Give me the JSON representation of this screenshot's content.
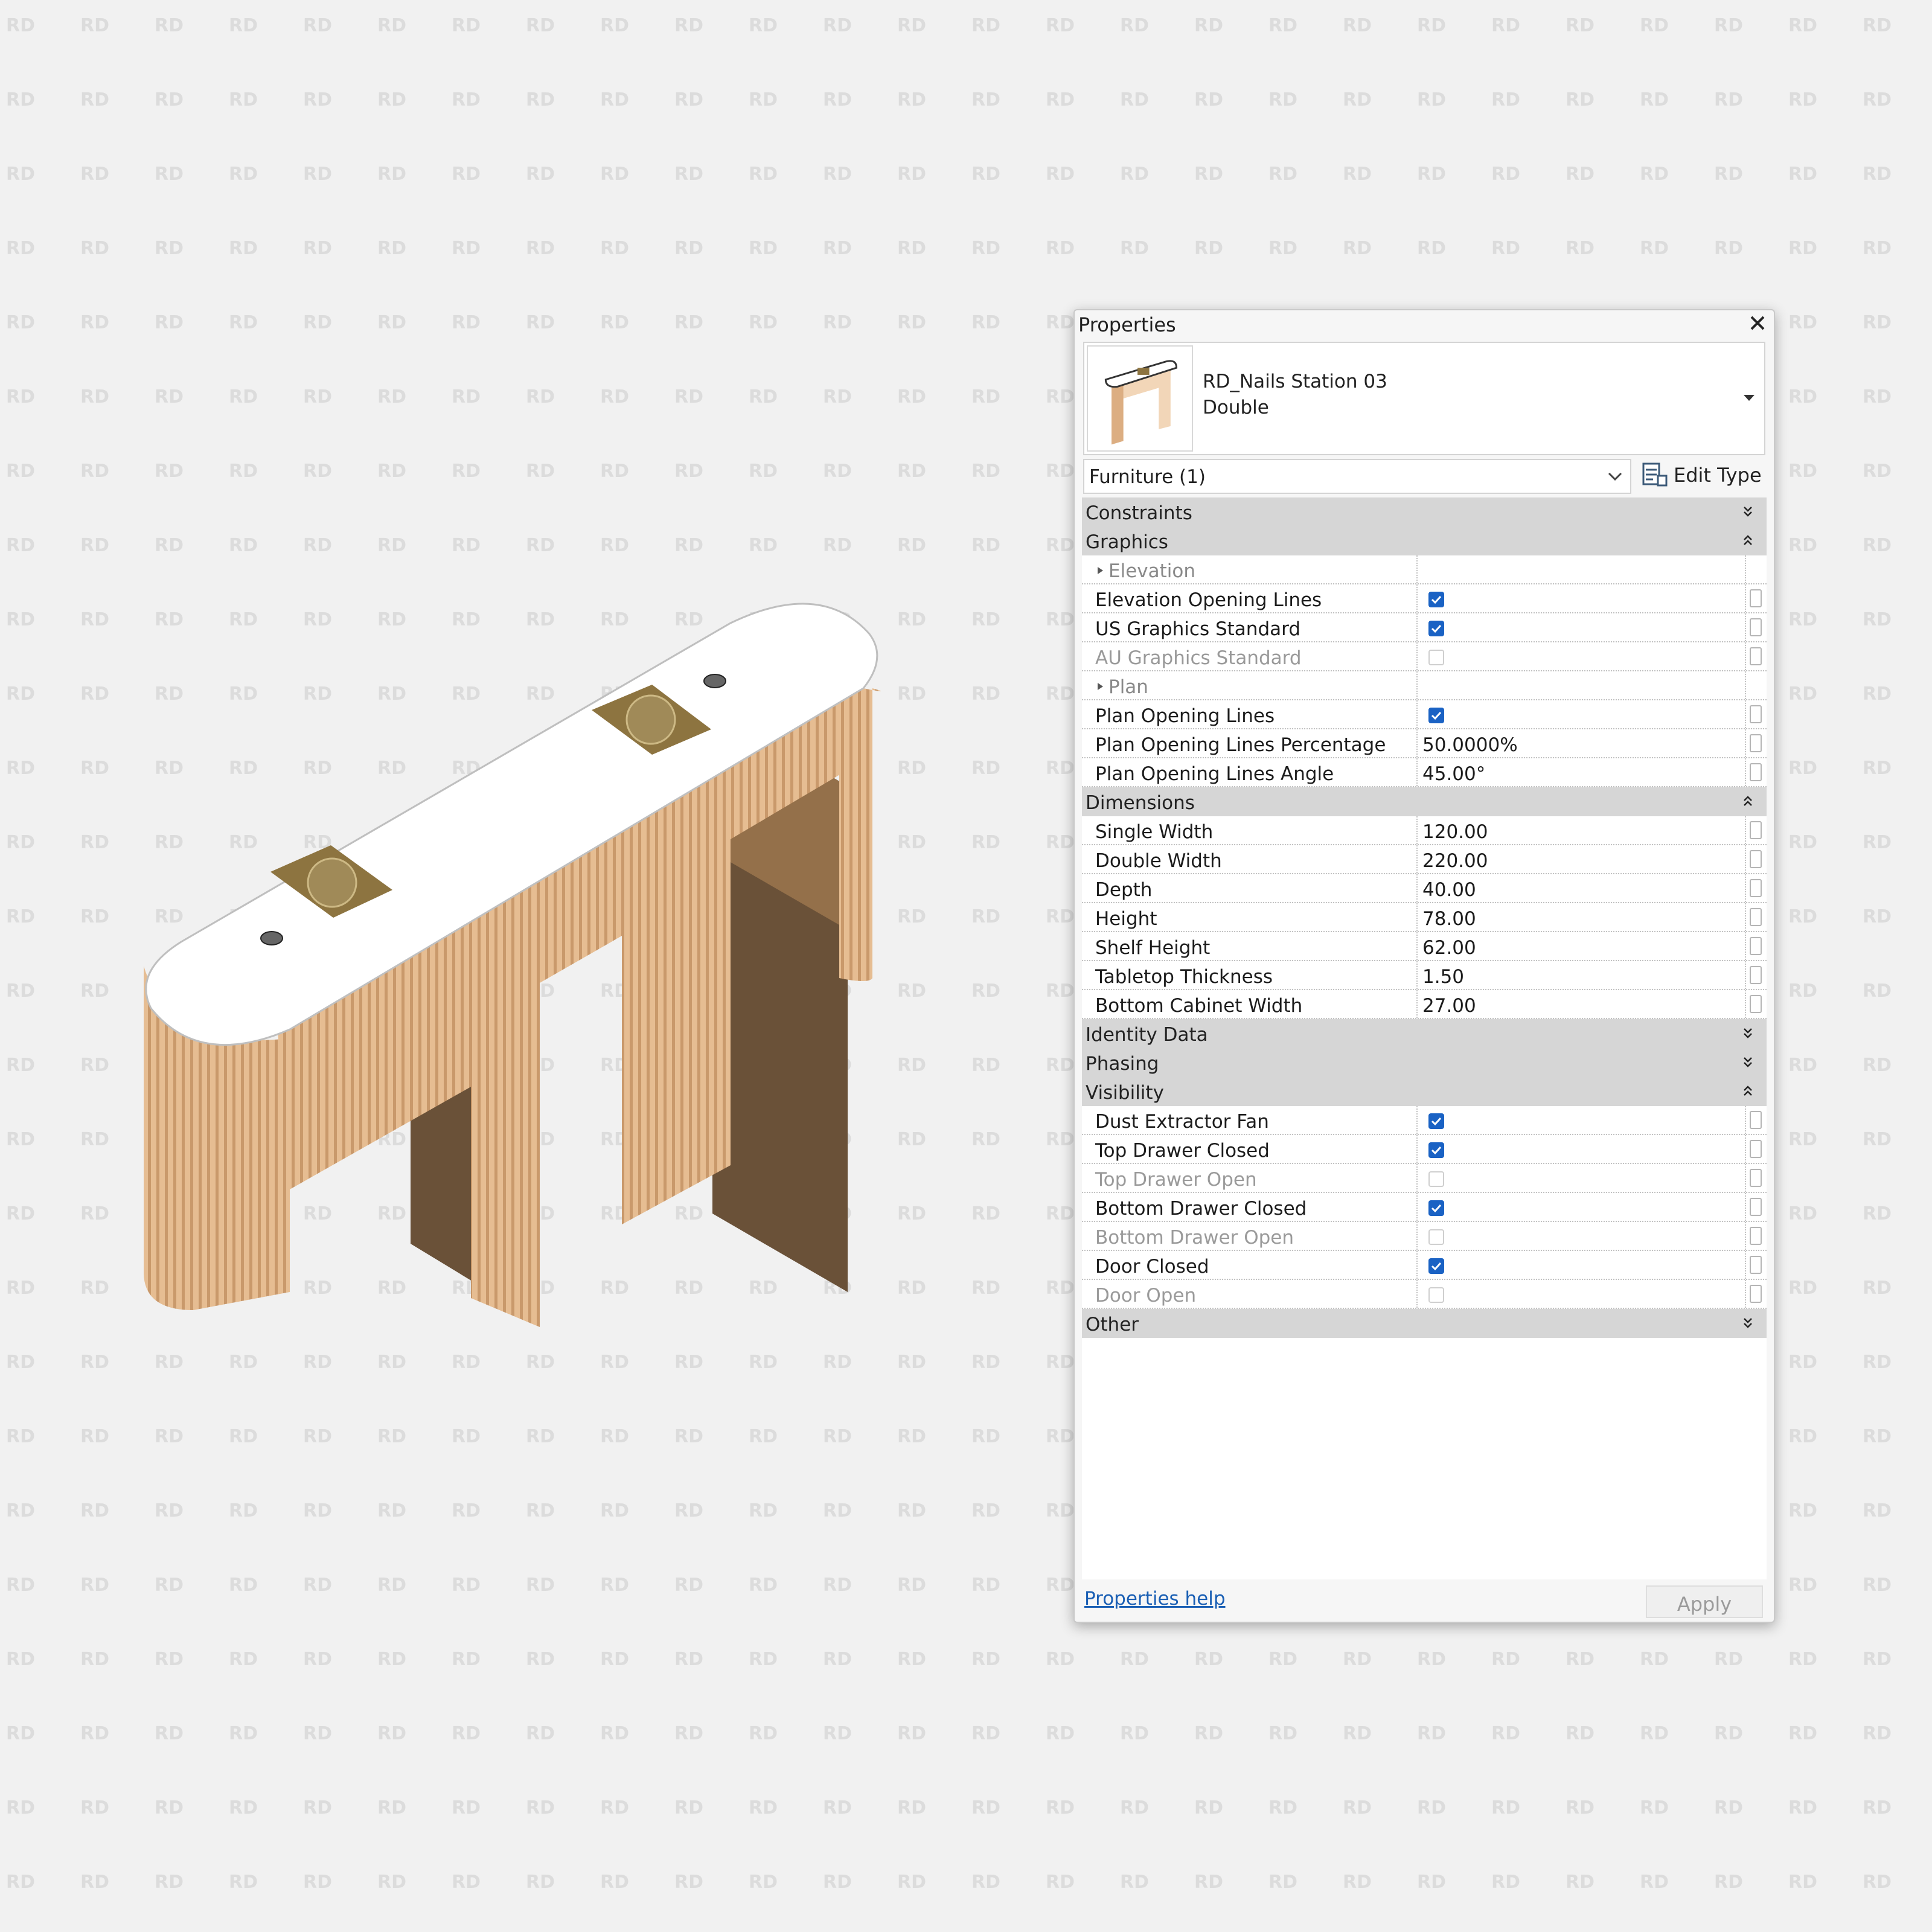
{
  "watermark_text": "RD",
  "panel": {
    "title": "Properties",
    "type_selector": {
      "family": "RD_Nails Station 03",
      "type": "Double"
    },
    "filter": {
      "value": "Furniture (1)"
    },
    "edit_type_label": "Edit Type",
    "help_link": "Properties help",
    "apply_label": "Apply"
  },
  "rows": [
    {
      "kind": "group",
      "label": "Constraints",
      "state": "collapsed"
    },
    {
      "kind": "group",
      "label": "Graphics",
      "state": "expanded"
    },
    {
      "kind": "subgroup",
      "label": "Elevation"
    },
    {
      "kind": "param",
      "name": "Elevation Opening Lines",
      "type": "checkbox",
      "checked": true,
      "enabled": true
    },
    {
      "kind": "param",
      "name": "US Graphics Standard",
      "type": "checkbox",
      "checked": true,
      "enabled": true
    },
    {
      "kind": "param",
      "name": "AU Graphics Standard",
      "type": "checkbox",
      "checked": false,
      "enabled": false
    },
    {
      "kind": "subgroup",
      "label": "Plan"
    },
    {
      "kind": "param",
      "name": "Plan Opening Lines",
      "type": "checkbox",
      "checked": true,
      "enabled": true
    },
    {
      "kind": "param",
      "name": "Plan Opening Lines Percentage",
      "type": "text",
      "value": "50.0000%",
      "enabled": true
    },
    {
      "kind": "param",
      "name": "Plan Opening Lines Angle",
      "type": "text",
      "value": "45.00°",
      "enabled": true
    },
    {
      "kind": "group",
      "label": "Dimensions",
      "state": "expanded"
    },
    {
      "kind": "param",
      "name": "Single Width",
      "type": "text",
      "value": "120.00",
      "enabled": true
    },
    {
      "kind": "param",
      "name": "Double Width",
      "type": "text",
      "value": "220.00",
      "enabled": true
    },
    {
      "kind": "param",
      "name": "Depth",
      "type": "text",
      "value": "40.00",
      "enabled": true
    },
    {
      "kind": "param",
      "name": "Height",
      "type": "text",
      "value": "78.00",
      "enabled": true
    },
    {
      "kind": "param",
      "name": "Shelf Height",
      "type": "text",
      "value": "62.00",
      "enabled": true
    },
    {
      "kind": "param",
      "name": "Tabletop Thickness",
      "type": "text",
      "value": "1.50",
      "enabled": true
    },
    {
      "kind": "param",
      "name": "Bottom Cabinet Width",
      "type": "text",
      "value": "27.00",
      "enabled": true
    },
    {
      "kind": "group",
      "label": "Identity Data",
      "state": "collapsed"
    },
    {
      "kind": "group",
      "label": "Phasing",
      "state": "collapsed"
    },
    {
      "kind": "group",
      "label": "Visibility",
      "state": "expanded"
    },
    {
      "kind": "param",
      "name": "Dust Extractor Fan",
      "type": "checkbox",
      "checked": true,
      "enabled": true
    },
    {
      "kind": "param",
      "name": "Top Drawer Closed",
      "type": "checkbox",
      "checked": true,
      "enabled": true
    },
    {
      "kind": "param",
      "name": "Top Drawer Open",
      "type": "checkbox",
      "checked": false,
      "enabled": false
    },
    {
      "kind": "param",
      "name": "Bottom Drawer Closed",
      "type": "checkbox",
      "checked": true,
      "enabled": true
    },
    {
      "kind": "param",
      "name": "Bottom Drawer Open",
      "type": "checkbox",
      "checked": false,
      "enabled": false
    },
    {
      "kind": "param",
      "name": "Door Closed",
      "type": "checkbox",
      "checked": true,
      "enabled": true
    },
    {
      "kind": "param",
      "name": "Door Open",
      "type": "checkbox",
      "checked": false,
      "enabled": false
    },
    {
      "kind": "group",
      "label": "Other",
      "state": "collapsed"
    }
  ],
  "colors": {
    "background": "#f1f1f1",
    "watermark": "#dcdcdc",
    "group_header": "#d6d6d6",
    "checkbox_checked": "#1a62c4",
    "link": "#1a5fb4",
    "countertop": "#ffffff",
    "fluted_wood_light": "#e6bd92",
    "fluted_wood_dark": "#c9996b",
    "cabinet_front": "#94704a",
    "cabinet_side": "#6a5138",
    "vent_plate": "#8d7440"
  }
}
